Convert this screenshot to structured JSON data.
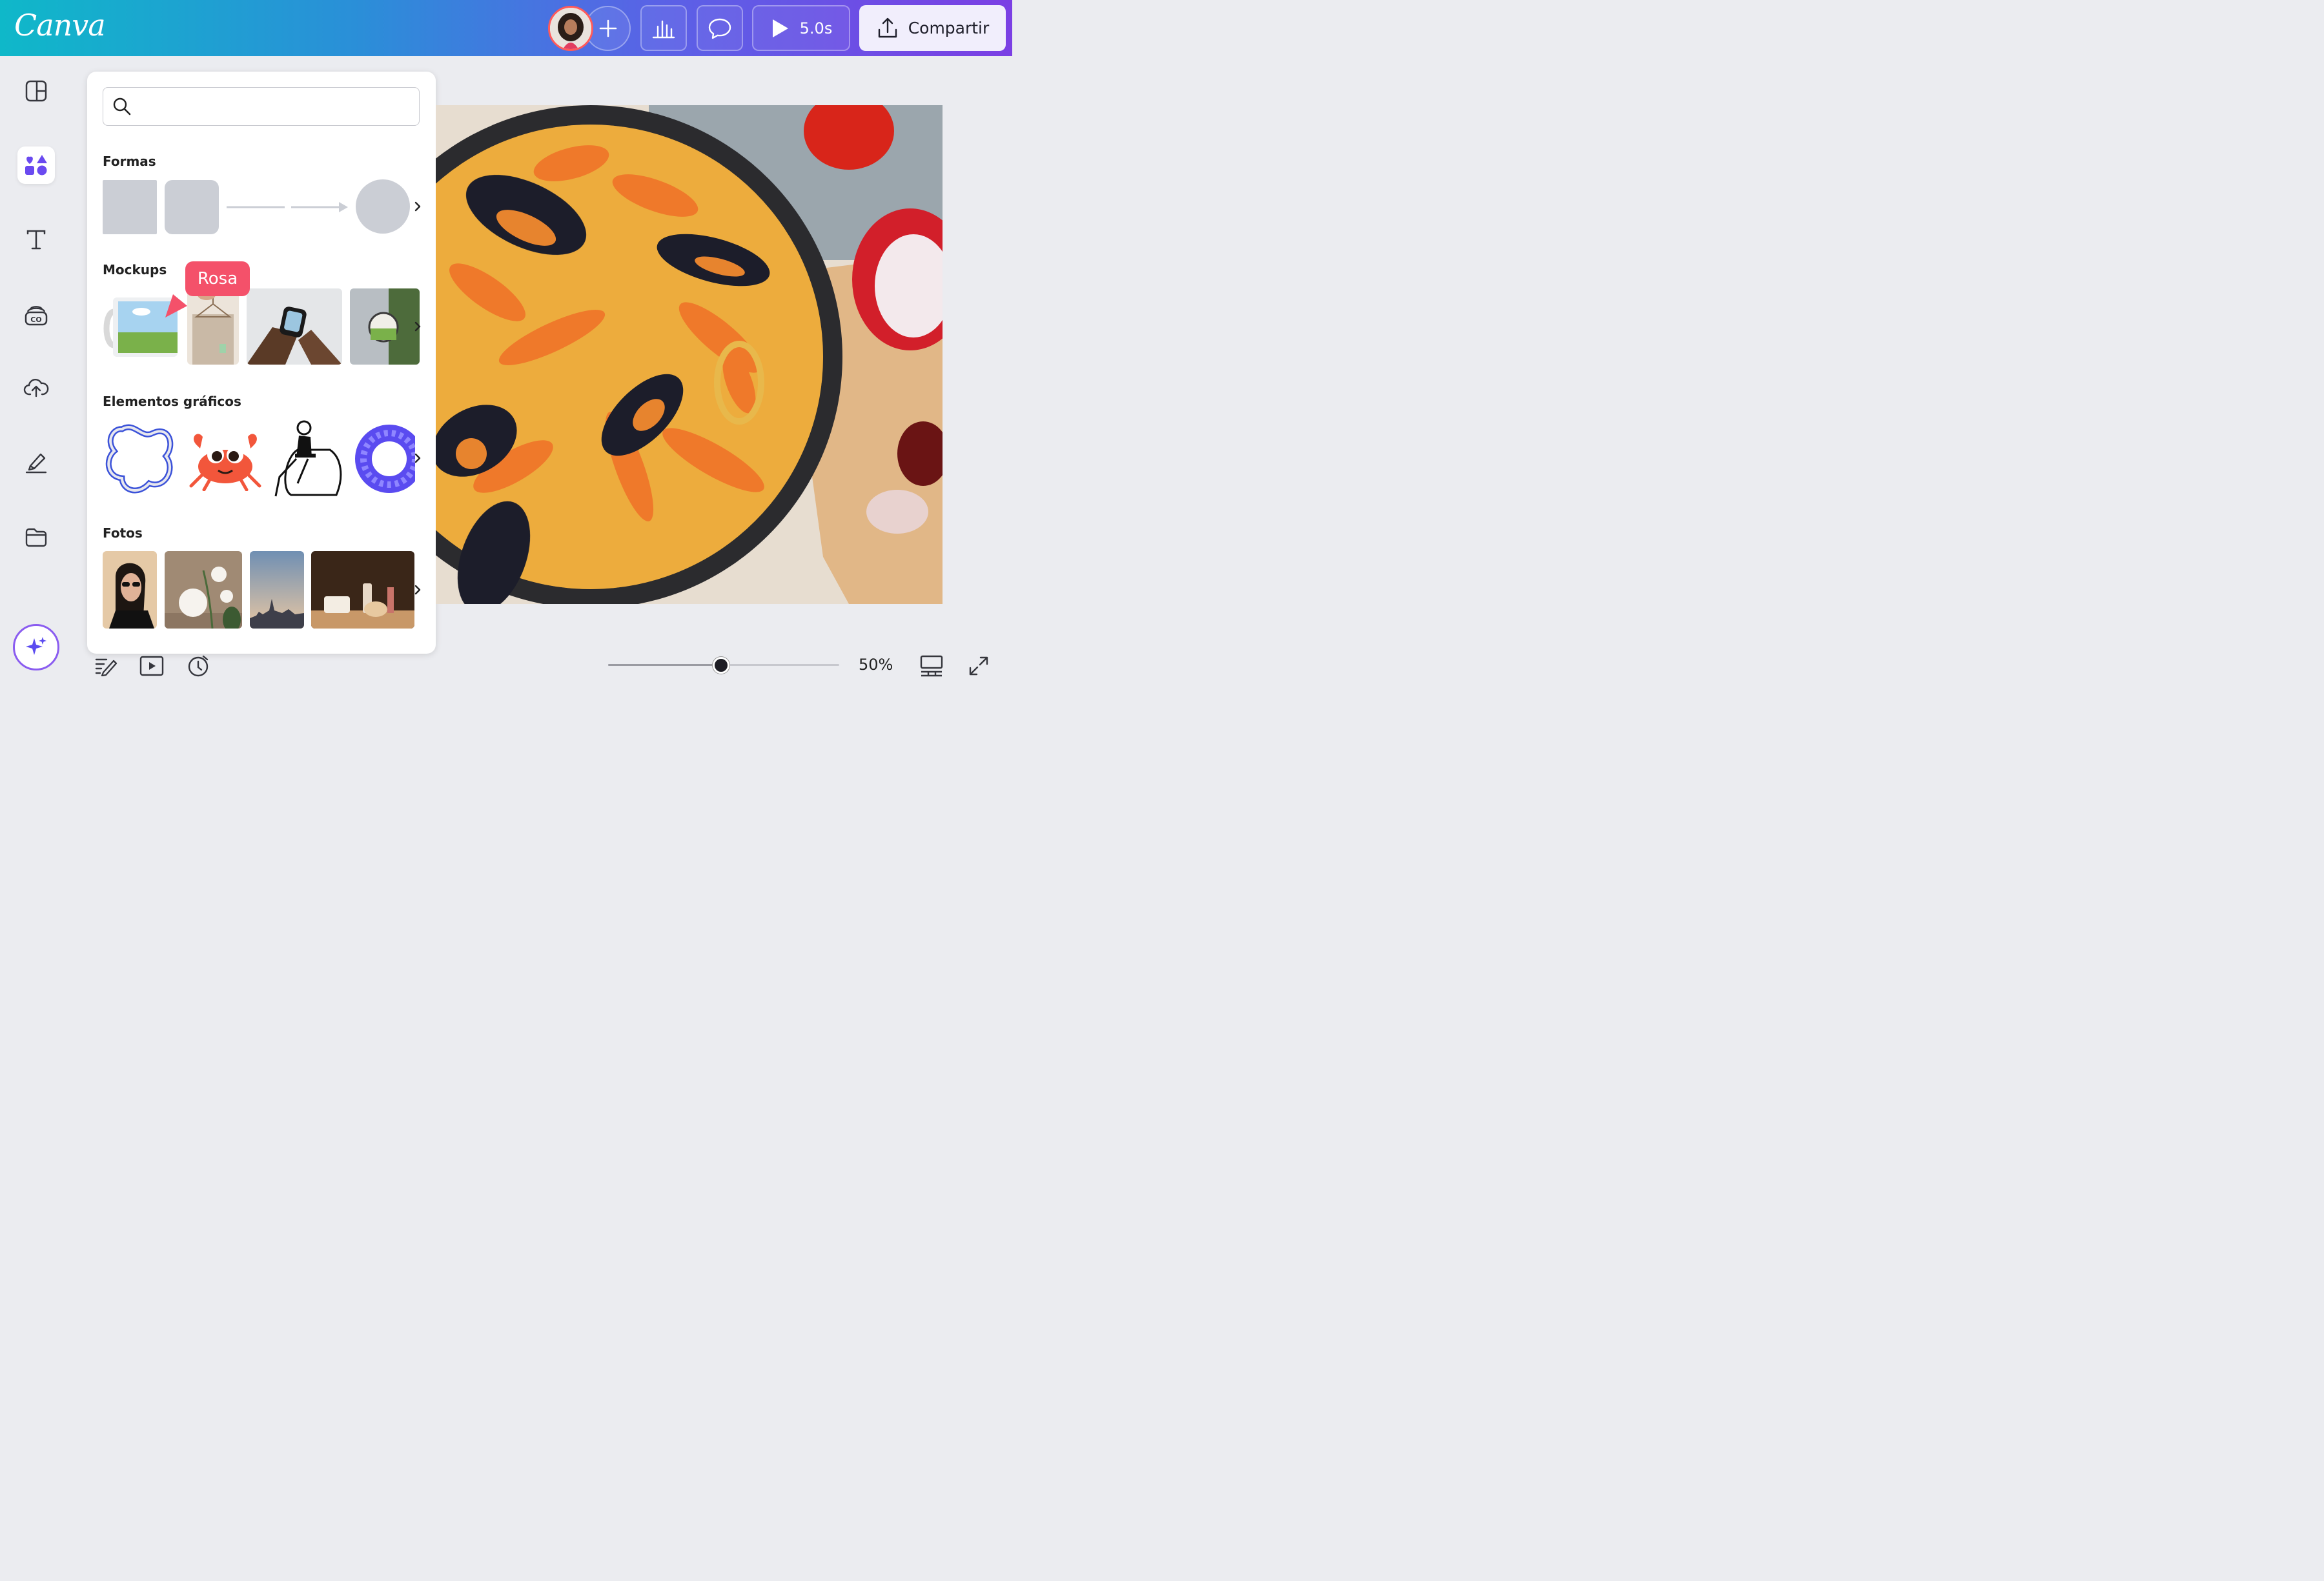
{
  "brand": {
    "logo_text": "Canva"
  },
  "header": {
    "play_duration": "5.0s",
    "share_label": "Compartir"
  },
  "panel": {
    "search_placeholder": "",
    "sections": {
      "shapes": {
        "title": "Formas"
      },
      "mockups": {
        "title": "Mockups",
        "tooltip": "Rosa"
      },
      "graphics": {
        "title": "Elementos gráficos"
      },
      "photos": {
        "title": "Fotos"
      }
    }
  },
  "zoom": {
    "label": "50%",
    "level_fraction": 0.49
  },
  "colors": {
    "tooltip": "#f4516a",
    "accent_purple": "#7b3fe4",
    "teal": "#0fb8c9"
  },
  "icons": [
    "layout-icon",
    "elements-icon",
    "text-icon",
    "brand-icon",
    "upload-icon",
    "draw-icon",
    "projects-icon",
    "magic-icon",
    "notes-icon",
    "present-icon",
    "timer-icon",
    "grid-view-icon",
    "fullscreen-icon",
    "search-icon",
    "chevron-right-icon",
    "analytics-icon",
    "comment-icon",
    "share-icon",
    "plus-icon",
    "play-icon"
  ]
}
